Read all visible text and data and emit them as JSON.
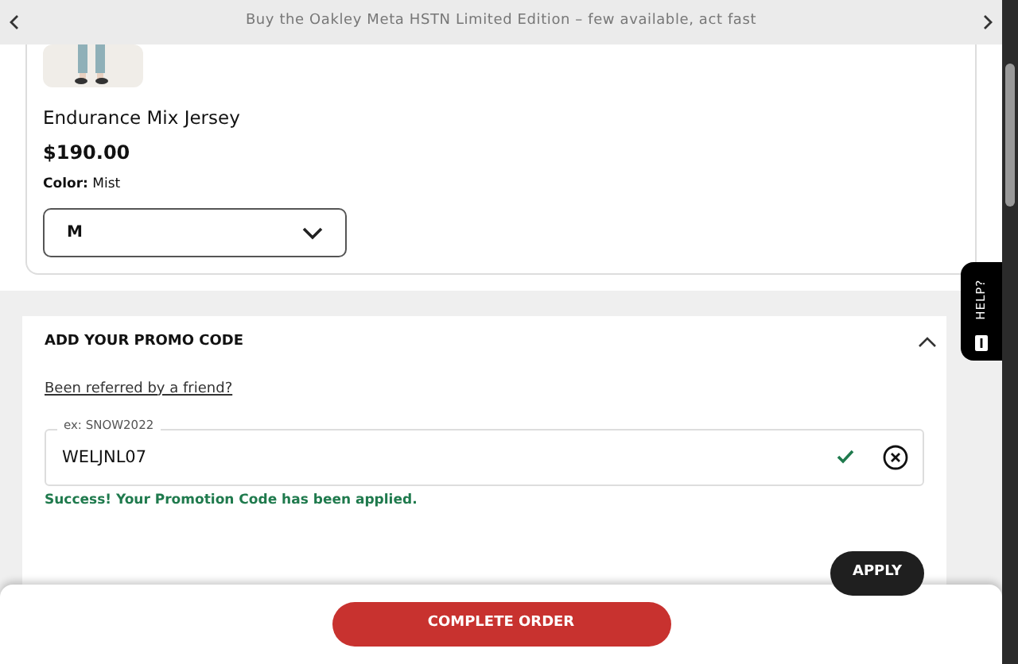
{
  "banner": {
    "text": "Buy the Oakley Meta HSTN Limited Edition – few available, act fast"
  },
  "product": {
    "name": "Endurance Mix Jersey",
    "price": "$190.00",
    "color_label": "Color:",
    "color_value": "Mist",
    "size": "M"
  },
  "help_tab": {
    "label": "HELP?"
  },
  "promo": {
    "title": "ADD YOUR PROMO CODE",
    "expanded": true,
    "referral_link": "Been referred by a friend?",
    "label": "ex: SNOW2022",
    "value": "WELJNL07",
    "valid": true,
    "message": "Success! Your Promotion Code has been applied.",
    "apply_button": "APPLY"
  },
  "checkout": {
    "button": "COMPLETE ORDER"
  }
}
